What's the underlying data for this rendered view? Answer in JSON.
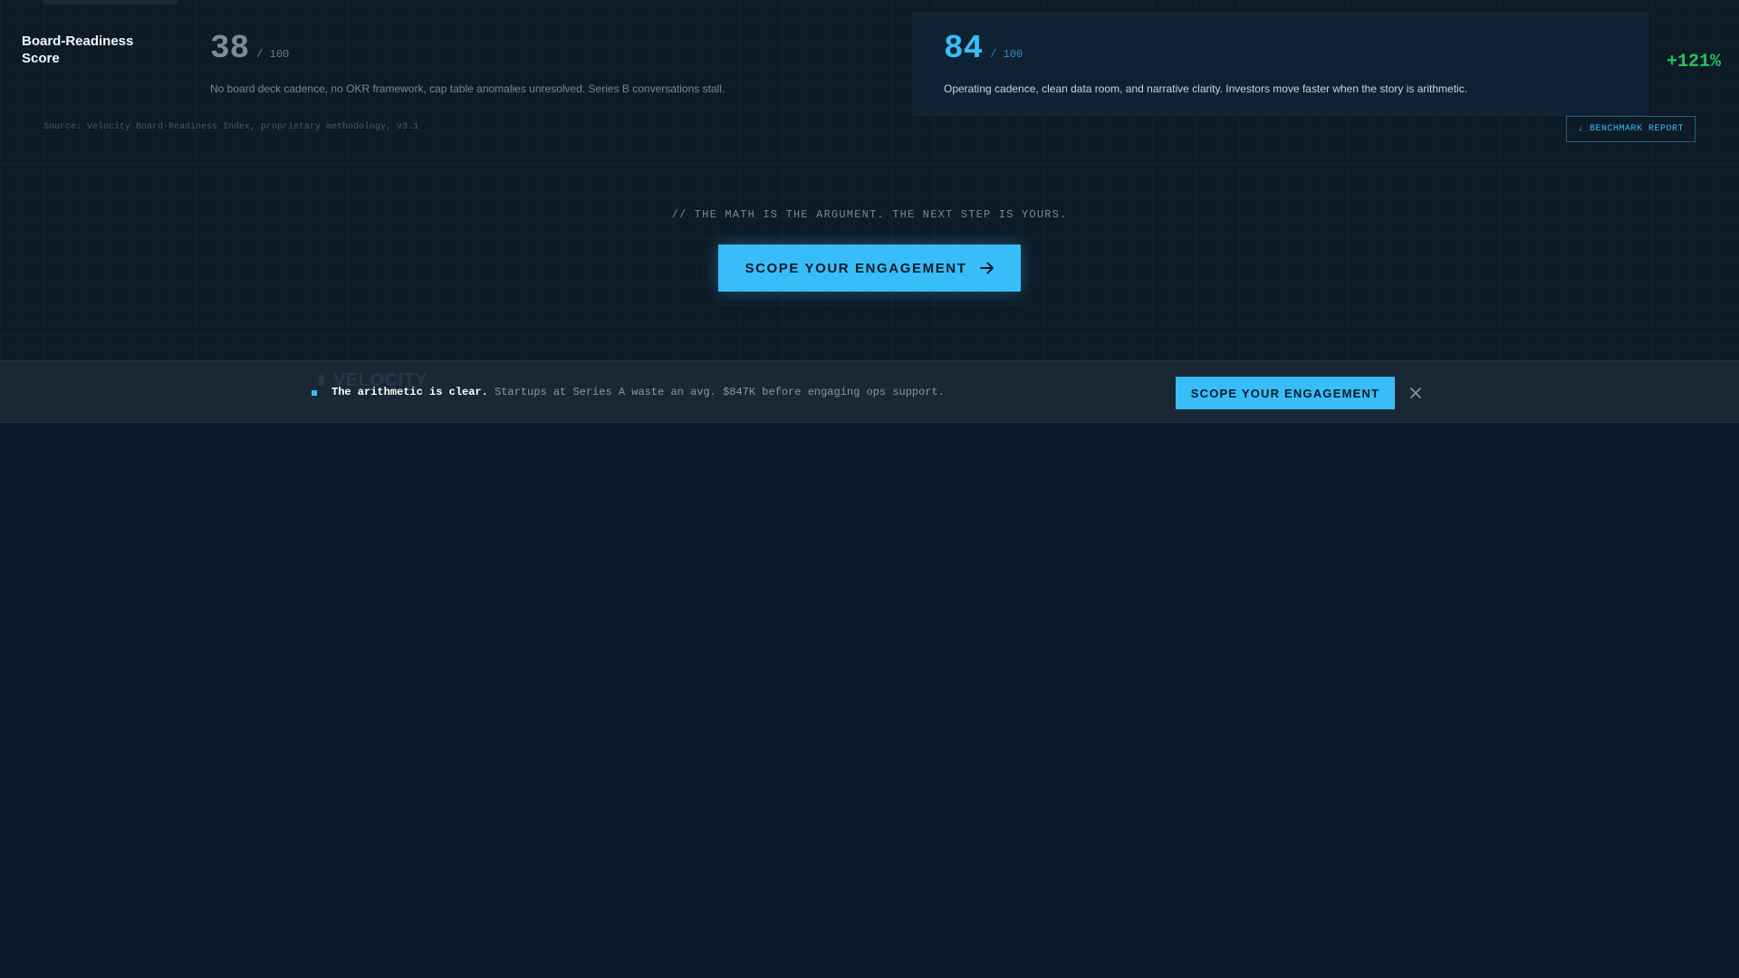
{
  "metric": {
    "label": "Board-Readiness Score",
    "before": {
      "score": "38",
      "denominator": "/ 100",
      "description": "No board deck cadence, no OKR framework, cap table anomalies unresolved. Series B conversations stall."
    },
    "after": {
      "score": "84",
      "denominator": "/ 100",
      "description": "Operating cadence, clean data room, and narrative clarity. Investors move faster when the story is arithmetic."
    },
    "delta": "+121%",
    "source": "Source: Velocity Board-Readiness Index, proprietary methodology, v3.1",
    "benchmark_button": "↓ BENCHMARK REPORT"
  },
  "cta": {
    "caption": "// THE MATH IS THE ARGUMENT. THE NEXT STEP IS YOURS.",
    "button_label": "SCOPE YOUR ENGAGEMENT",
    "button_icon": "arrow-right-icon"
  },
  "sticky_bar": {
    "logo_text": "VELOCITY",
    "headline": "The arithmetic is clear.",
    "message": "Startups at Series A waste an avg. $847K before engaging ops support.",
    "button_label": "SCOPE YOUR ENGAGEMENT",
    "close_icon": "close-icon"
  },
  "colors": {
    "accent": "#38bdf8",
    "positive": "#22c55e",
    "background": "#0a1929"
  }
}
